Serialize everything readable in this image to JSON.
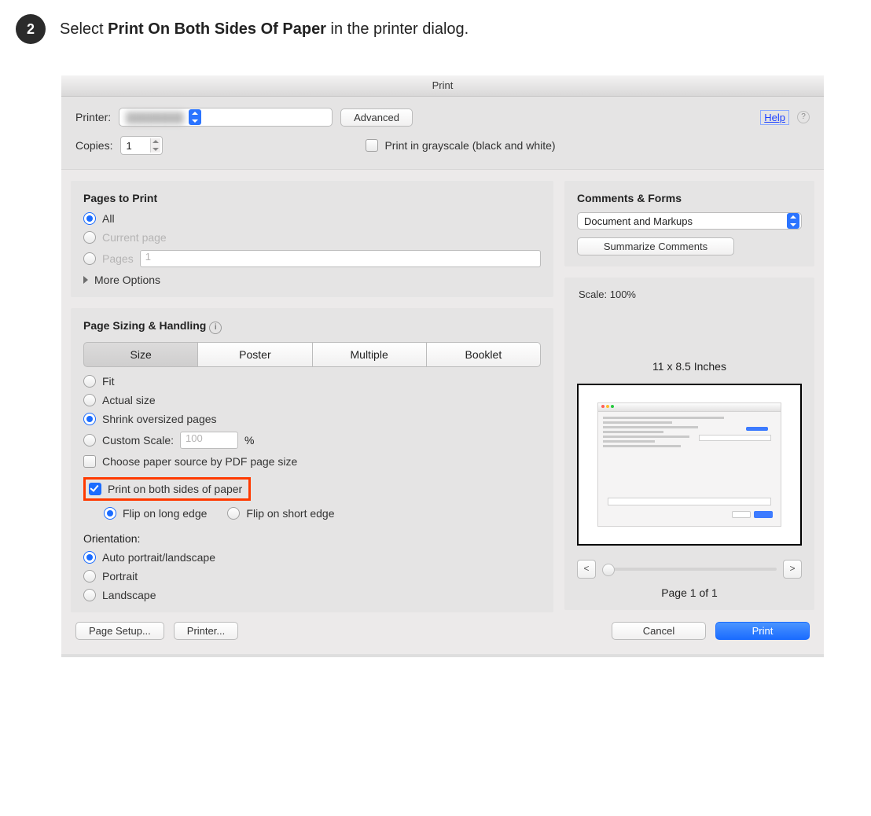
{
  "step": {
    "num": "2",
    "prefix": "Select ",
    "bold": "Print On Both Sides Of Paper",
    "suffix": " in the printer dialog."
  },
  "dialog": {
    "title": "Print",
    "printer_label": "Printer:",
    "advanced": "Advanced",
    "help": "Help",
    "copies_label": "Copies:",
    "copies_value": "1",
    "grayscale": "Print in grayscale (black and white)"
  },
  "pages": {
    "header": "Pages to Print",
    "all": "All",
    "current": "Current page",
    "pages": "Pages",
    "pages_value": "1",
    "more": "More Options"
  },
  "sizing": {
    "header": "Page Sizing & Handling",
    "tabs": {
      "size": "Size",
      "poster": "Poster",
      "multiple": "Multiple",
      "booklet": "Booklet"
    },
    "fit": "Fit",
    "actual": "Actual size",
    "shrink": "Shrink oversized pages",
    "custom": "Custom Scale:",
    "custom_value": "100",
    "percent": "%",
    "choose_source": "Choose paper source by PDF page size",
    "both_sides": "Print on both sides of paper",
    "flip_long": "Flip on long edge",
    "flip_short": "Flip on short edge",
    "orientation": "Orientation:",
    "auto": "Auto portrait/landscape",
    "portrait": "Portrait",
    "landscape": "Landscape"
  },
  "right": {
    "header": "Comments & Forms",
    "select": "Document and Markups",
    "summarize": "Summarize Comments",
    "scale": "Scale: 100%",
    "dims": "11 x 8.5 Inches",
    "prev": "<",
    "next": ">",
    "page_of": "Page 1 of 1"
  },
  "footer": {
    "page_setup": "Page Setup...",
    "printer": "Printer...",
    "cancel": "Cancel",
    "print": "Print"
  }
}
